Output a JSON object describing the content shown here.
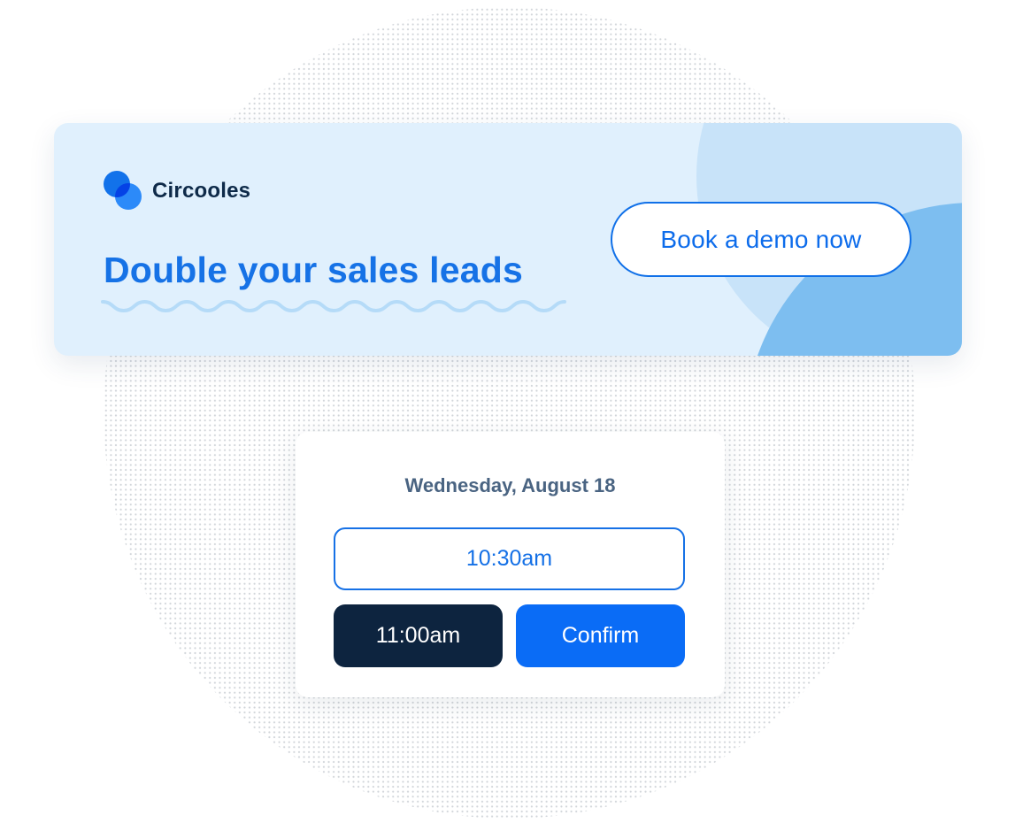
{
  "banner": {
    "brand_name": "Circooles",
    "logo_icon": "overlapping-circles-logo",
    "headline": "Double your sales leads",
    "cta_label": "Book a demo now"
  },
  "scheduler": {
    "date": "Wednesday, August 18",
    "time_slots": [
      {
        "label": "10:30am",
        "state": "outlined"
      },
      {
        "label": "11:00am",
        "state": "selected"
      }
    ],
    "confirm_label": "Confirm"
  },
  "colors": {
    "brand_blue": "#1672e6",
    "confirm_blue": "#0a6cf6",
    "dark_navy": "#0d243f",
    "banner_bg": "#e0f0fd",
    "wave": "#b5dbf8"
  }
}
